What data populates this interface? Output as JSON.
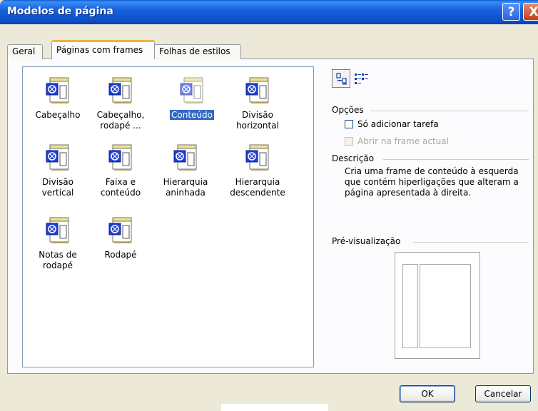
{
  "window": {
    "title": "Modelos de página",
    "help_label": "?",
    "close_label": "X"
  },
  "tabs": [
    {
      "label": "Geral",
      "active": false
    },
    {
      "label": "Páginas com frames",
      "active": true
    },
    {
      "label": "Folhas de estilos",
      "active": false
    }
  ],
  "templates": [
    {
      "label": "Cabeçalho"
    },
    {
      "label": "Cabeçalho, rodapé ..."
    },
    {
      "label": "Conteúdo",
      "selected": true
    },
    {
      "label": "Divisão horizontal"
    },
    {
      "label": "Divisão vertical"
    },
    {
      "label": "Faixa e conteúdo"
    },
    {
      "label": "Hierarquia aninhada"
    },
    {
      "label": "Hierarquia descendente"
    },
    {
      "label": "Notas de rodapé"
    },
    {
      "label": "Rodapé"
    }
  ],
  "options": {
    "heading": "Opções",
    "add_task_label": "Só adicionar tarefa",
    "add_task_checked": false,
    "open_current_label": "Abrir na frame actual",
    "open_current_enabled": false
  },
  "description": {
    "heading": "Descrição",
    "text": "Cria uma frame de conteúdo à esquerda que contém hiperligações que alteram a página apresentada à direita."
  },
  "preview": {
    "heading": "Pré-visualização"
  },
  "buttons": {
    "ok": "OK",
    "cancel": "Cancelar"
  },
  "colors": {
    "titlebar": "#0d4fc9",
    "selection": "#316ac5",
    "tab_highlight": "#f0b33c"
  },
  "icons": {
    "template": "frame-page-template-icon",
    "large_icons_view": "large-icons-view-icon",
    "list_view": "list-view-icon"
  }
}
